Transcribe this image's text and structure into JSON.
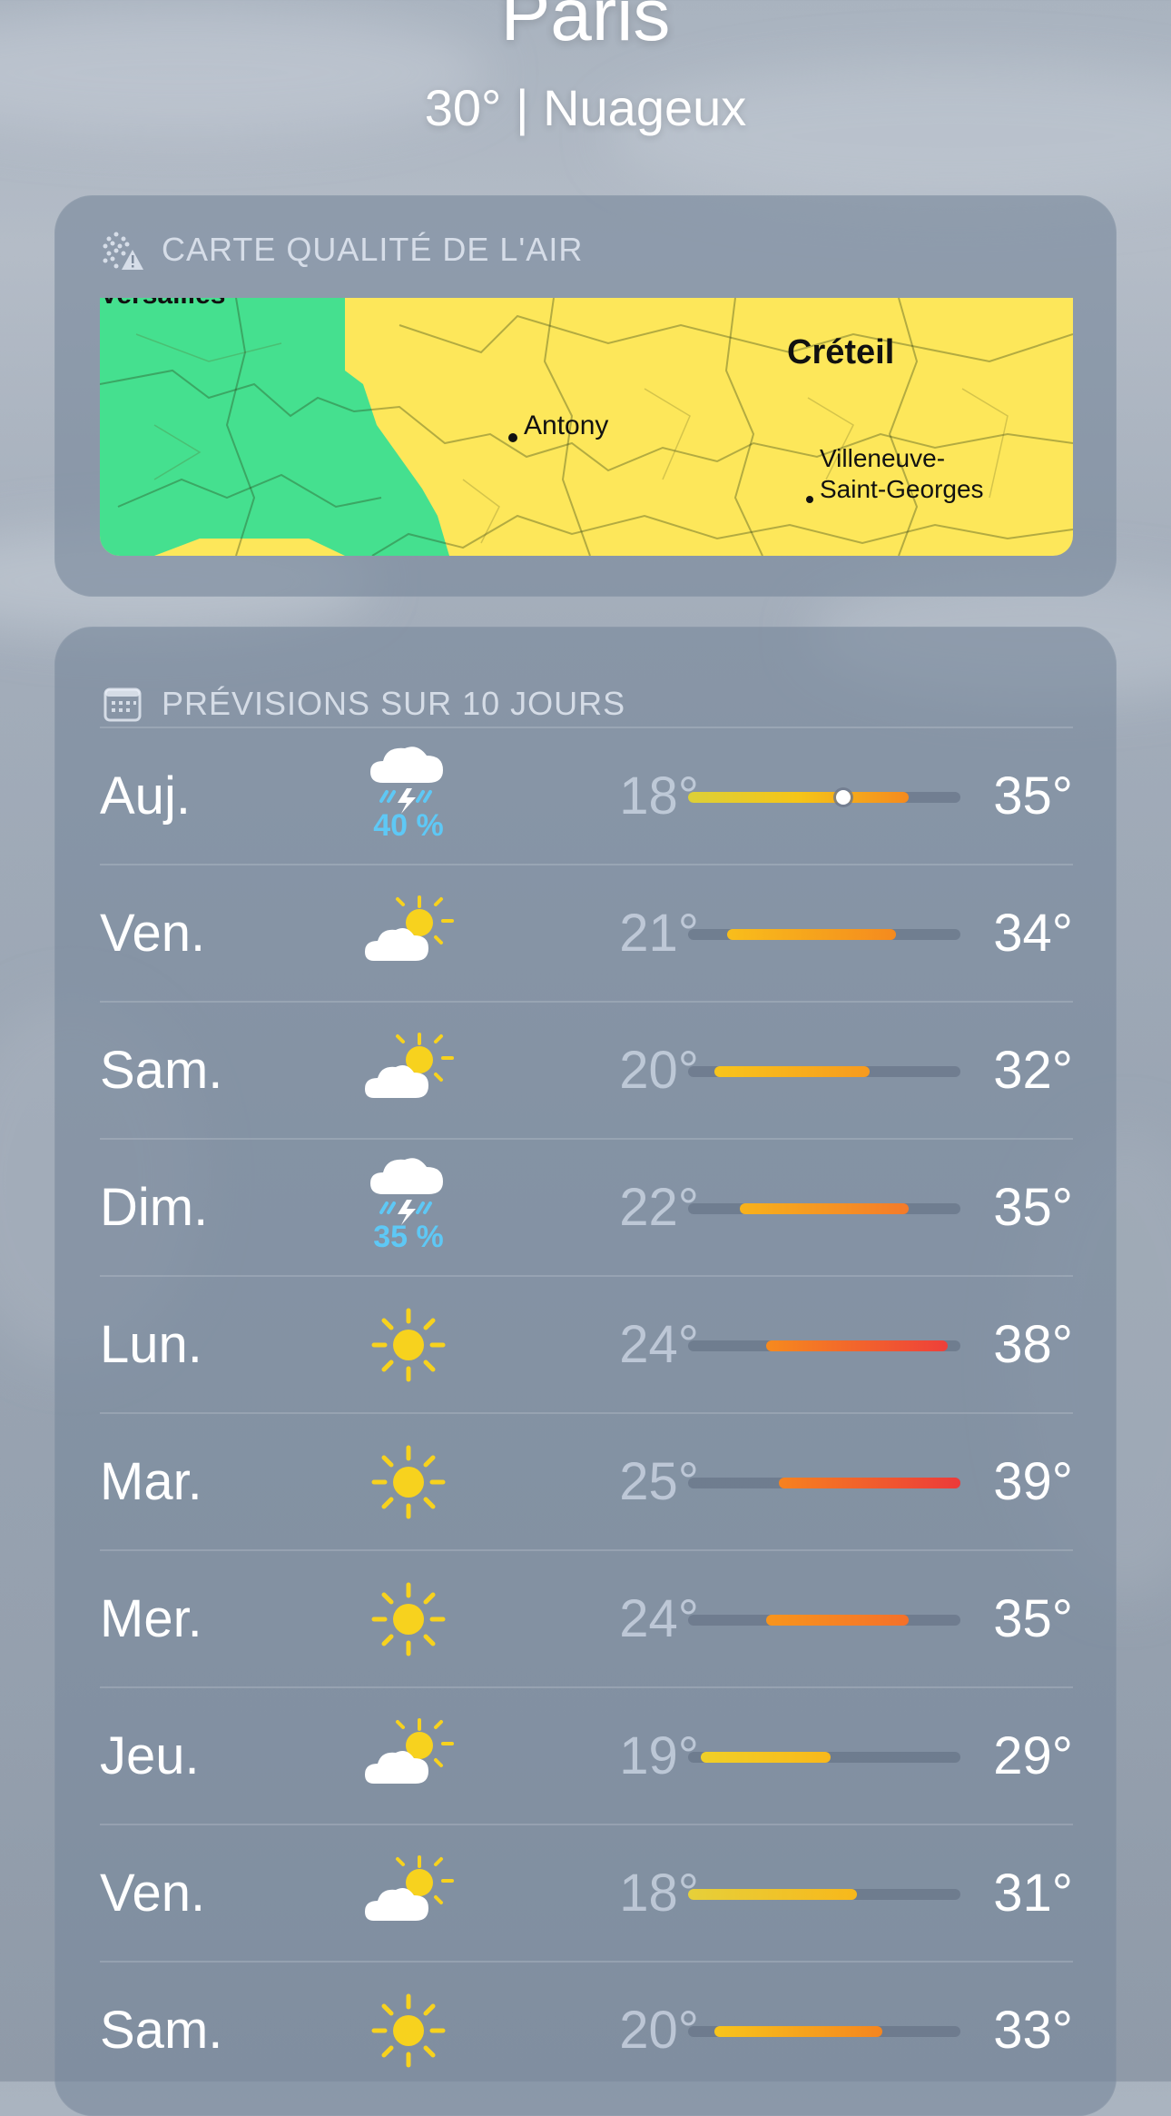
{
  "header": {
    "city": "Paris",
    "condition": "30°  |  Nuageux"
  },
  "air_quality": {
    "title": "CARTE QUALITÉ DE L'AIR",
    "icon": "air-quality-warning-icon",
    "labels": {
      "top_left": "Versailles",
      "creteil": "Créteil",
      "antony": "Antony",
      "villeneuve_1": "Villeneuve-",
      "villeneuve_2": "Saint-Georges"
    },
    "colors": {
      "good": "#45e08f",
      "moderate": "#fde75a"
    }
  },
  "forecast": {
    "title": "PRÉVISIONS SUR 10 JOURS",
    "icon": "calendar-icon",
    "scale": {
      "min": 18,
      "max": 39
    },
    "days": [
      {
        "day": "Auj.",
        "icon": "thunderstorm-icon",
        "precip": "40 %",
        "low": "18°",
        "high": "35°",
        "low_v": 18,
        "high_v": 35,
        "current_v": 30,
        "colors": [
          "#dcd038",
          "#f5c518",
          "#f58a1e"
        ]
      },
      {
        "day": "Ven.",
        "icon": "partly-sunny-icon",
        "precip": "",
        "low": "21°",
        "high": "34°",
        "low_v": 21,
        "high_v": 34,
        "colors": [
          "#f8be1b",
          "#f58a1e"
        ]
      },
      {
        "day": "Sam.",
        "icon": "partly-sunny-icon",
        "precip": "",
        "low": "20°",
        "high": "32°",
        "low_v": 20,
        "high_v": 32,
        "colors": [
          "#f8c51b",
          "#f79a1e"
        ]
      },
      {
        "day": "Dim.",
        "icon": "thunderstorm-icon",
        "precip": "35 %",
        "low": "22°",
        "high": "35°",
        "low_v": 22,
        "high_v": 35,
        "colors": [
          "#f8b21b",
          "#f47a2a"
        ]
      },
      {
        "day": "Lun.",
        "icon": "sun-icon",
        "precip": "",
        "low": "24°",
        "high": "38°",
        "low_v": 24,
        "high_v": 38,
        "colors": [
          "#f68a1e",
          "#ee3f3a"
        ]
      },
      {
        "day": "Mar.",
        "icon": "sun-icon",
        "precip": "",
        "low": "25°",
        "high": "39°",
        "low_v": 25,
        "high_v": 39,
        "colors": [
          "#f6821f",
          "#ec3a3a"
        ]
      },
      {
        "day": "Mer.",
        "icon": "sun-icon",
        "precip": "",
        "low": "24°",
        "high": "35°",
        "low_v": 24,
        "high_v": 35,
        "colors": [
          "#f8951c",
          "#f4702a"
        ]
      },
      {
        "day": "Jeu.",
        "icon": "partly-sunny-icon",
        "precip": "",
        "low": "19°",
        "high": "29°",
        "low_v": 19,
        "high_v": 29,
        "colors": [
          "#f0d028",
          "#f8b81b"
        ]
      },
      {
        "day": "Ven.",
        "icon": "partly-sunny-icon",
        "precip": "",
        "low": "18°",
        "high": "31°",
        "low_v": 18,
        "high_v": 31,
        "colors": [
          "#e6d03a",
          "#f8b81b"
        ]
      },
      {
        "day": "Sam.",
        "icon": "sun-icon",
        "precip": "",
        "low": "20°",
        "high": "33°",
        "low_v": 20,
        "high_v": 33,
        "colors": [
          "#f8c51b",
          "#f5851f"
        ]
      }
    ]
  }
}
